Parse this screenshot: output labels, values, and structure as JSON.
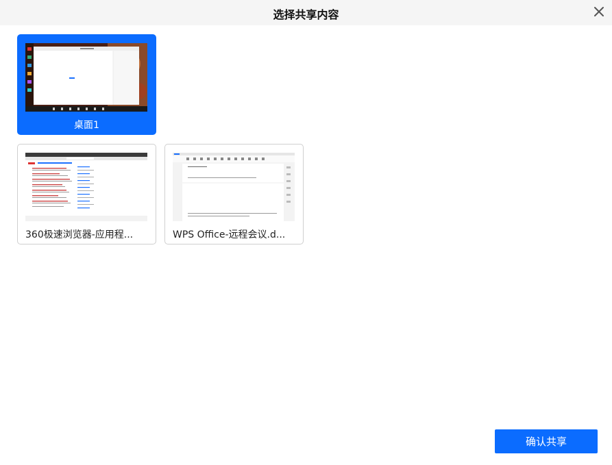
{
  "dialog": {
    "title": "选择共享内容",
    "close_icon": "close-icon"
  },
  "cards": [
    {
      "label": "桌面1",
      "selected": true
    },
    {
      "label": "360极速浏览器-应用程...",
      "selected": false
    },
    {
      "label": "WPS Office-远程会议.d...",
      "selected": false
    }
  ],
  "confirm_button": {
    "label": "确认共享"
  },
  "colors": {
    "accent": "#0b6cff",
    "titlebar": "#f5f5f5",
    "card_border": "#cfcfcf"
  }
}
